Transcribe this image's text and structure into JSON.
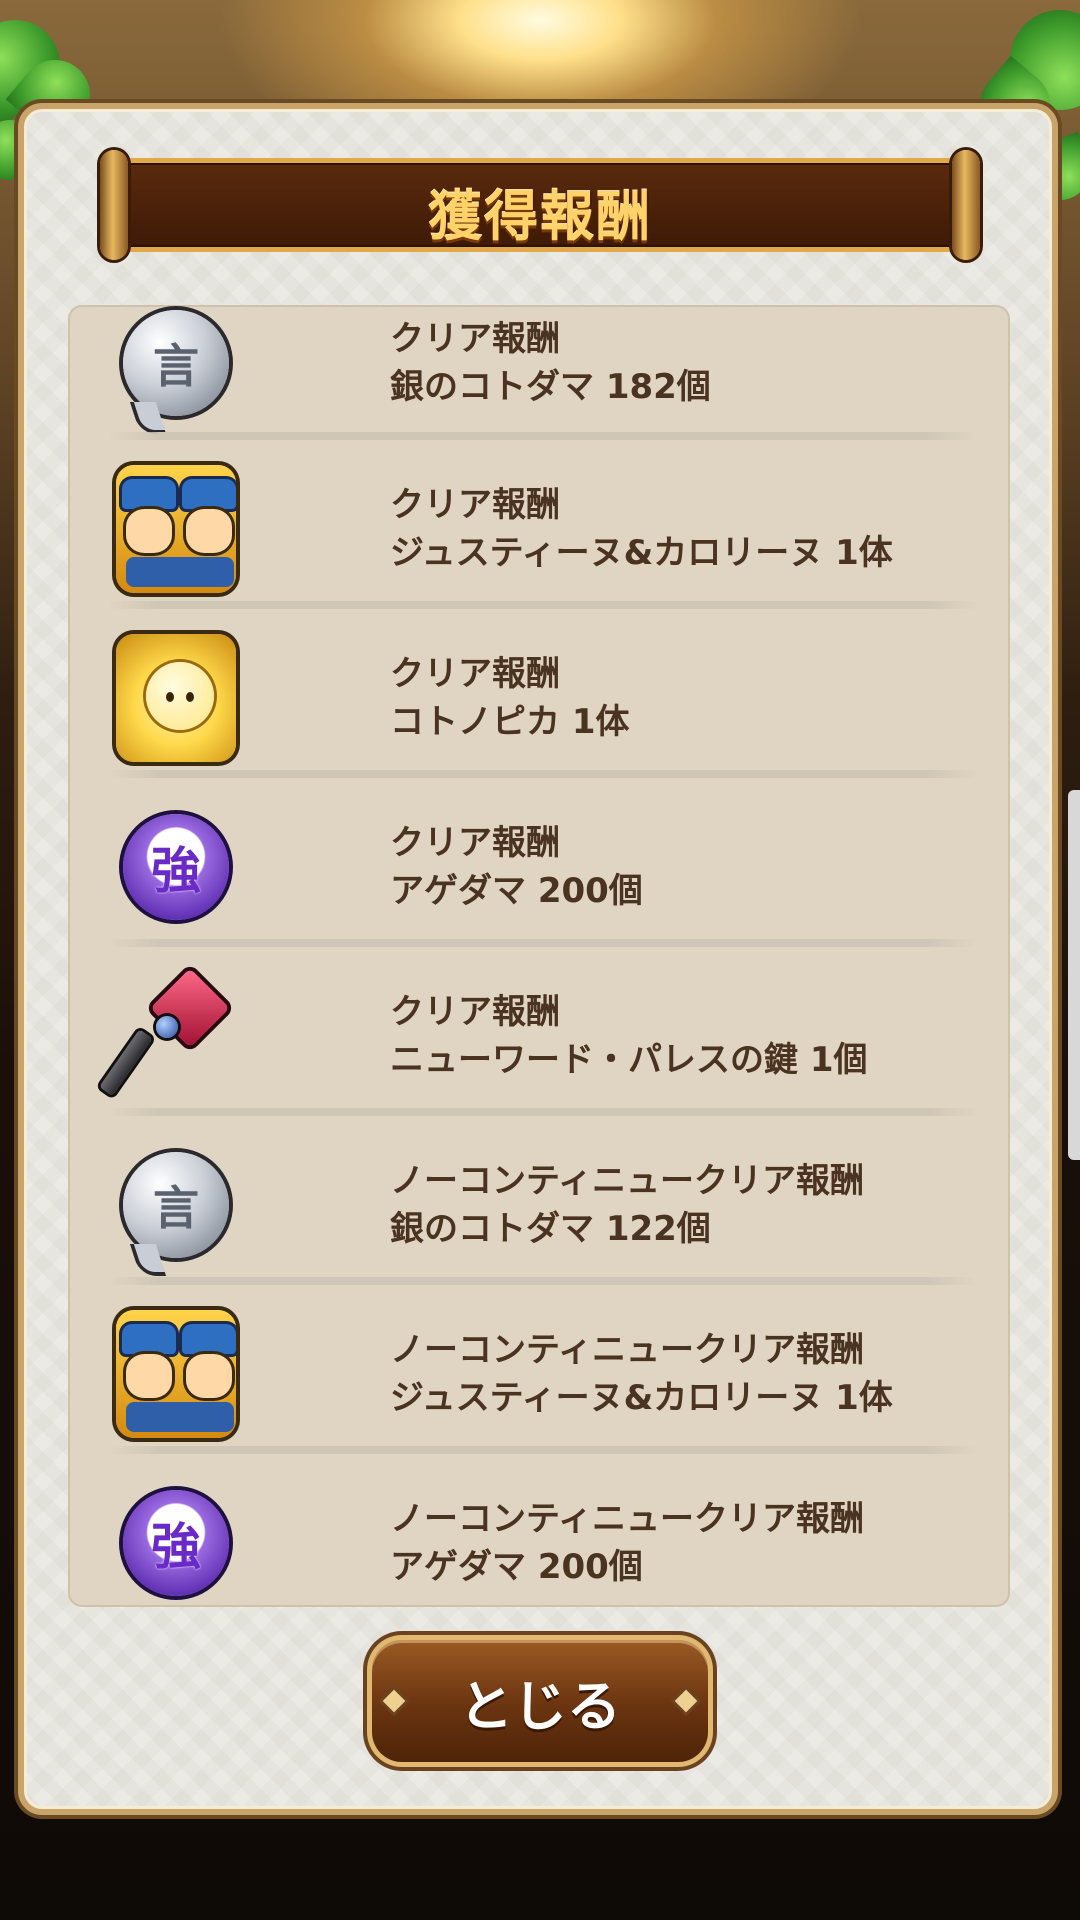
{
  "dialog": {
    "title": "獲得報酬",
    "close_label": "とじる"
  },
  "rewards": [
    {
      "icon": "silver-kotodama-icon",
      "glyph": "言",
      "category": "クリア報酬",
      "item": "銀のコトダマ 182個"
    },
    {
      "icon": "justine-caroline-card-icon",
      "category": "クリア報酬",
      "item": "ジュスティーヌ&カロリーヌ 1体"
    },
    {
      "icon": "kotonopika-card-icon",
      "category": "クリア報酬",
      "item": "コトノピカ 1体"
    },
    {
      "icon": "agedama-orb-icon",
      "glyph": "強",
      "category": "クリア報酬",
      "item": "アゲダマ 200個"
    },
    {
      "icon": "palace-key-icon",
      "category": "クリア報酬",
      "item": "ニューワード・パレスの鍵 1個"
    },
    {
      "icon": "silver-kotodama-icon",
      "glyph": "言",
      "category": "ノーコンティニュークリア報酬",
      "item": "銀のコトダマ 122個"
    },
    {
      "icon": "justine-caroline-card-icon",
      "category": "ノーコンティニュークリア報酬",
      "item": "ジュスティーヌ&カロリーヌ 1体"
    },
    {
      "icon": "agedama-orb-icon",
      "glyph": "強",
      "category": "ノーコンティニュークリア報酬",
      "item": "アゲダマ 200個"
    }
  ]
}
